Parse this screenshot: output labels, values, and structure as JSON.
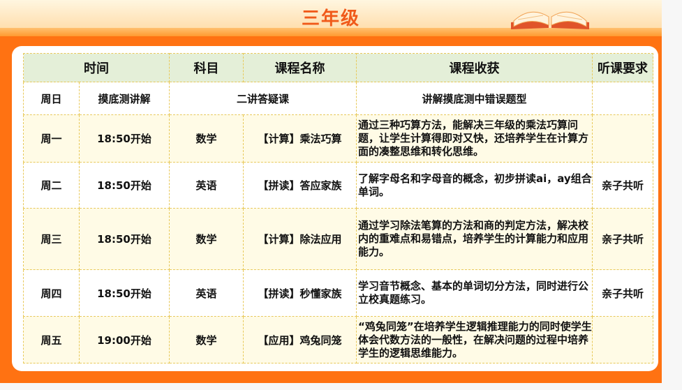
{
  "title": "三年级",
  "headers": {
    "time": "时间",
    "subject": "科目",
    "course": "课程名称",
    "gain": "课程收获",
    "req": "听课要求"
  },
  "intro_row": {
    "day": "周日",
    "time": "摸底测讲解",
    "course": "二讲答疑课",
    "gain": "讲解摸底测中错误题型",
    "req": ""
  },
  "rows": [
    {
      "day": "周一",
      "time": "18:50开始",
      "subject": "数学",
      "course": "【计算】乘法巧算",
      "gain": "通过三种巧算方法，能解决三年级的乘法巧算问题，让学生计算得即对又快，还培养学生在计算方面的凑整思维和转化思维。",
      "req": ""
    },
    {
      "day": "周二",
      "time": "18:50开始",
      "subject": "英语",
      "course": "【拼读】答应家族",
      "gain": "了解字母名和字母音的概念，初步拼读ai，ay组合单词。",
      "req": "亲子共听"
    },
    {
      "day": "周三",
      "time": "18:50开始",
      "subject": "数学",
      "course": "【计算】除法应用",
      "gain": "通过学习除法笔算的方法和商的判定方法，解决校内的重难点和易错点，培养学生的计算能力和应用能力。",
      "req": "亲子共听"
    },
    {
      "day": "周四",
      "time": "18:50开始",
      "subject": "英语",
      "course": "【拼读】秒懂家族",
      "gain": "学习音节概念、基本的单词切分方法，同时进行公立校真题练习。",
      "req": "亲子共听"
    },
    {
      "day": "周五",
      "time": "19:00开始",
      "subject": "数学",
      "course": "【应用】鸡兔同笼",
      "gain": "“鸡兔同笼”在培养学生逻辑推理能力的同时使学生体会代数方法的一般性，在解决问题的过程中培养学生的逻辑思维能力。",
      "req": ""
    }
  ]
}
